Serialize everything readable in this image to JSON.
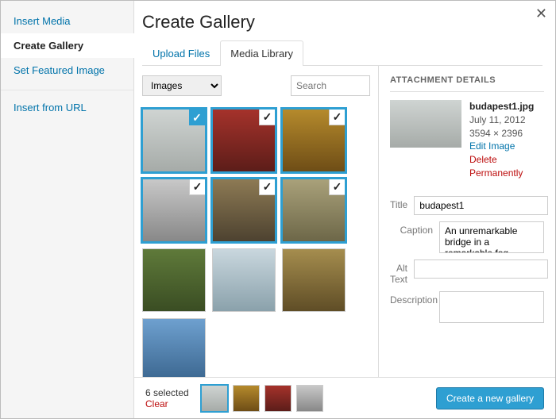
{
  "sidebar": {
    "items": [
      {
        "label": "Insert Media",
        "active": false
      },
      {
        "label": "Create Gallery",
        "active": true
      },
      {
        "label": "Set Featured Image",
        "active": false
      },
      {
        "label": "Insert from URL",
        "active": false,
        "separated": true
      }
    ]
  },
  "header": {
    "title": "Create Gallery",
    "close": "✕"
  },
  "tabs": [
    {
      "label": "Upload Files",
      "active": false
    },
    {
      "label": "Media Library",
      "active": true
    }
  ],
  "filters": {
    "type_select": "Images",
    "search_placeholder": "Search"
  },
  "grid": {
    "items": [
      {
        "cls": "img-bridge",
        "selected": true,
        "primary": true
      },
      {
        "cls": "img-woman",
        "selected": true,
        "primary": false
      },
      {
        "cls": "img-gold",
        "selected": true,
        "primary": false
      },
      {
        "cls": "img-bike",
        "selected": true,
        "primary": false
      },
      {
        "cls": "img-cath",
        "selected": true,
        "primary": false
      },
      {
        "cls": "img-city",
        "selected": true,
        "primary": false
      },
      {
        "cls": "img-camp",
        "selected": false,
        "primary": false
      },
      {
        "cls": "img-ship",
        "selected": false,
        "primary": false
      },
      {
        "cls": "img-buff",
        "selected": false,
        "primary": false
      },
      {
        "cls": "img-eiff",
        "selected": false,
        "primary": false
      }
    ]
  },
  "details": {
    "heading": "ATTACHMENT DETAILS",
    "filename": "budapest1.jpg",
    "date": "July 11, 2012",
    "dims": "3594 × 2396",
    "edit_link": "Edit Image",
    "delete_link": "Delete Permanently",
    "fields": {
      "title_label": "Title",
      "title_value": "budapest1",
      "caption_label": "Caption",
      "caption_value": "An unremarkable bridge in a remarkable fog.",
      "alt_label": "Alt Text",
      "alt_value": "",
      "desc_label": "Description",
      "desc_value": ""
    }
  },
  "footer": {
    "selected_text": "6 selected",
    "clear_text": "Clear",
    "strip": [
      "img-bridge",
      "img-gold",
      "img-woman",
      "img-bike"
    ],
    "create_label": "Create a new gallery"
  }
}
